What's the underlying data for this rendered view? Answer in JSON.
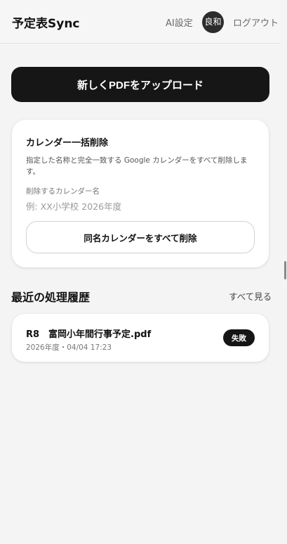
{
  "header": {
    "app_title": "予定表Sync",
    "ai_settings": "AI設定",
    "user_avatar": "良和",
    "logout": "ログアウト"
  },
  "upload": {
    "label": "新しくPDFをアップロード"
  },
  "bulk_delete": {
    "title": "カレンダー一括削除",
    "description": "指定した名称と完全一致する Google カレンダーをすべて削除します。",
    "field_label": "削除するカレンダー名",
    "input_value": "",
    "input_placeholder": "例: XX小学校 2026年度",
    "button_label": "同名カレンダーをすべて削除"
  },
  "history": {
    "title": "最近の処理履歴",
    "see_all": "すべて見る",
    "items": [
      {
        "name": "R8　富岡小年間行事予定.pdf",
        "meta": "2026年度・04/04 17:23",
        "status": "失敗"
      }
    ]
  },
  "colors": {
    "primary": "#161616",
    "background": "#f5f4f5",
    "card": "#ffffff"
  }
}
